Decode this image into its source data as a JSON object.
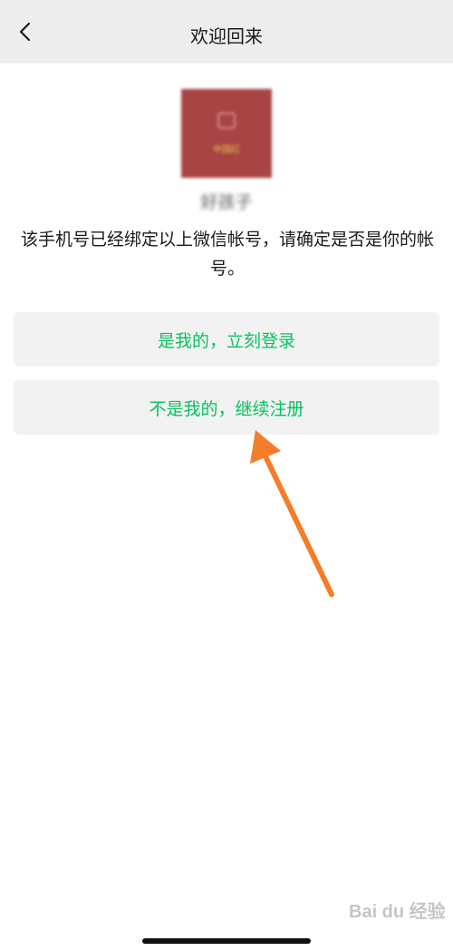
{
  "header": {
    "title": "欢迎回来"
  },
  "profile": {
    "nickname": "好孩子",
    "avatar_text": "中国红"
  },
  "message": "该手机号已经绑定以上微信帐号，请确定是否是你的帐号。",
  "actions": {
    "login_label": "是我的，立刻登录",
    "register_label": "不是我的，继续注册"
  },
  "watermark": "Bai du 经验",
  "colors": {
    "accent": "#07c160",
    "nav_bg": "#ededed",
    "button_bg": "#f2f2f2",
    "arrow": "#f57c2a",
    "avatar_bg": "#a84444"
  }
}
